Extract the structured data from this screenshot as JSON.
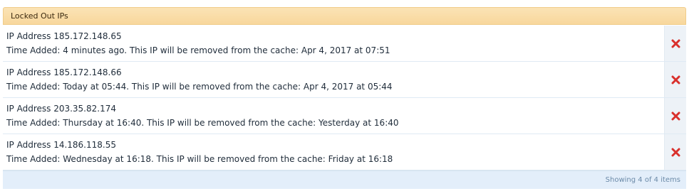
{
  "panel": {
    "title": "Locked Out IPs"
  },
  "rows": [
    {
      "ip_label": "IP Address 185.172.148.65",
      "time_label": "Time Added: 4 minutes ago. This IP will be removed from the cache: Apr 4, 2017 at 07:51",
      "action_icon": "delete-icon"
    },
    {
      "ip_label": "IP Address 185.172.148.66",
      "time_label": "Time Added: Today at 05:44. This IP will be removed from the cache: Apr 4, 2017 at 05:44",
      "action_icon": "delete-icon"
    },
    {
      "ip_label": "IP Address 203.35.82.174",
      "time_label": "Time Added: Thursday at 16:40. This IP will be removed from the cache: Yesterday at 16:40",
      "action_icon": "delete-icon"
    },
    {
      "ip_label": "IP Address 14.186.118.55",
      "time_label": "Time Added: Wednesday at 16:18. This IP will be removed from the cache: Friday at 16:18",
      "action_icon": "delete-icon"
    }
  ],
  "footer": {
    "summary": "Showing 4 of 4 items"
  },
  "colors": {
    "header_bg": "#f8d79c",
    "delete_icon": "#d9302c",
    "footer_text": "#6b8aa8"
  }
}
